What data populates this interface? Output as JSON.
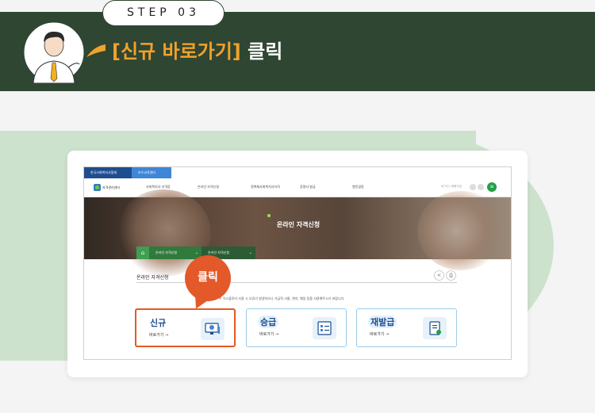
{
  "step": {
    "label": "STEP 03"
  },
  "headline": {
    "accent": "[신규 바로가기]",
    "rest": " 클릭"
  },
  "screen": {
    "top_tabs": [
      "한국사회복지사협회",
      "보수교육센터"
    ],
    "logo_text": "자격관리센터",
    "nav": [
      "사회복지사 자격증",
      "온라인 자격신청",
      "정책제사회복지사자격",
      "증명서 발급",
      "열린광장"
    ],
    "nav_util": "로그인 | 회원가입",
    "hero_title": "온라인 자격신청",
    "breadcrumb": [
      "온라인 자격신청",
      "온라인 자격신청"
    ],
    "section_title": "온라인 자격신청",
    "notice_mark": "※",
    "notice": "익스플로러 사용 시 오류가 발생하오니 가급적 크롬, 엣지, 웨일 등을 사용해주시기 바랍니다.",
    "options": [
      {
        "title": "신규",
        "go": "바로가기  →",
        "icon": "monitor-icon"
      },
      {
        "title": "승급",
        "go": "바로가기  →",
        "icon": "checklist-icon"
      },
      {
        "title": "재발급",
        "go": "바로가기  →",
        "icon": "document-icon"
      }
    ]
  },
  "callout": {
    "label": "클릭"
  },
  "colors": {
    "banner": "#2e4632",
    "accent": "#f2a12b",
    "highlight": "#e3592a",
    "green_area": "#cde2cd"
  }
}
